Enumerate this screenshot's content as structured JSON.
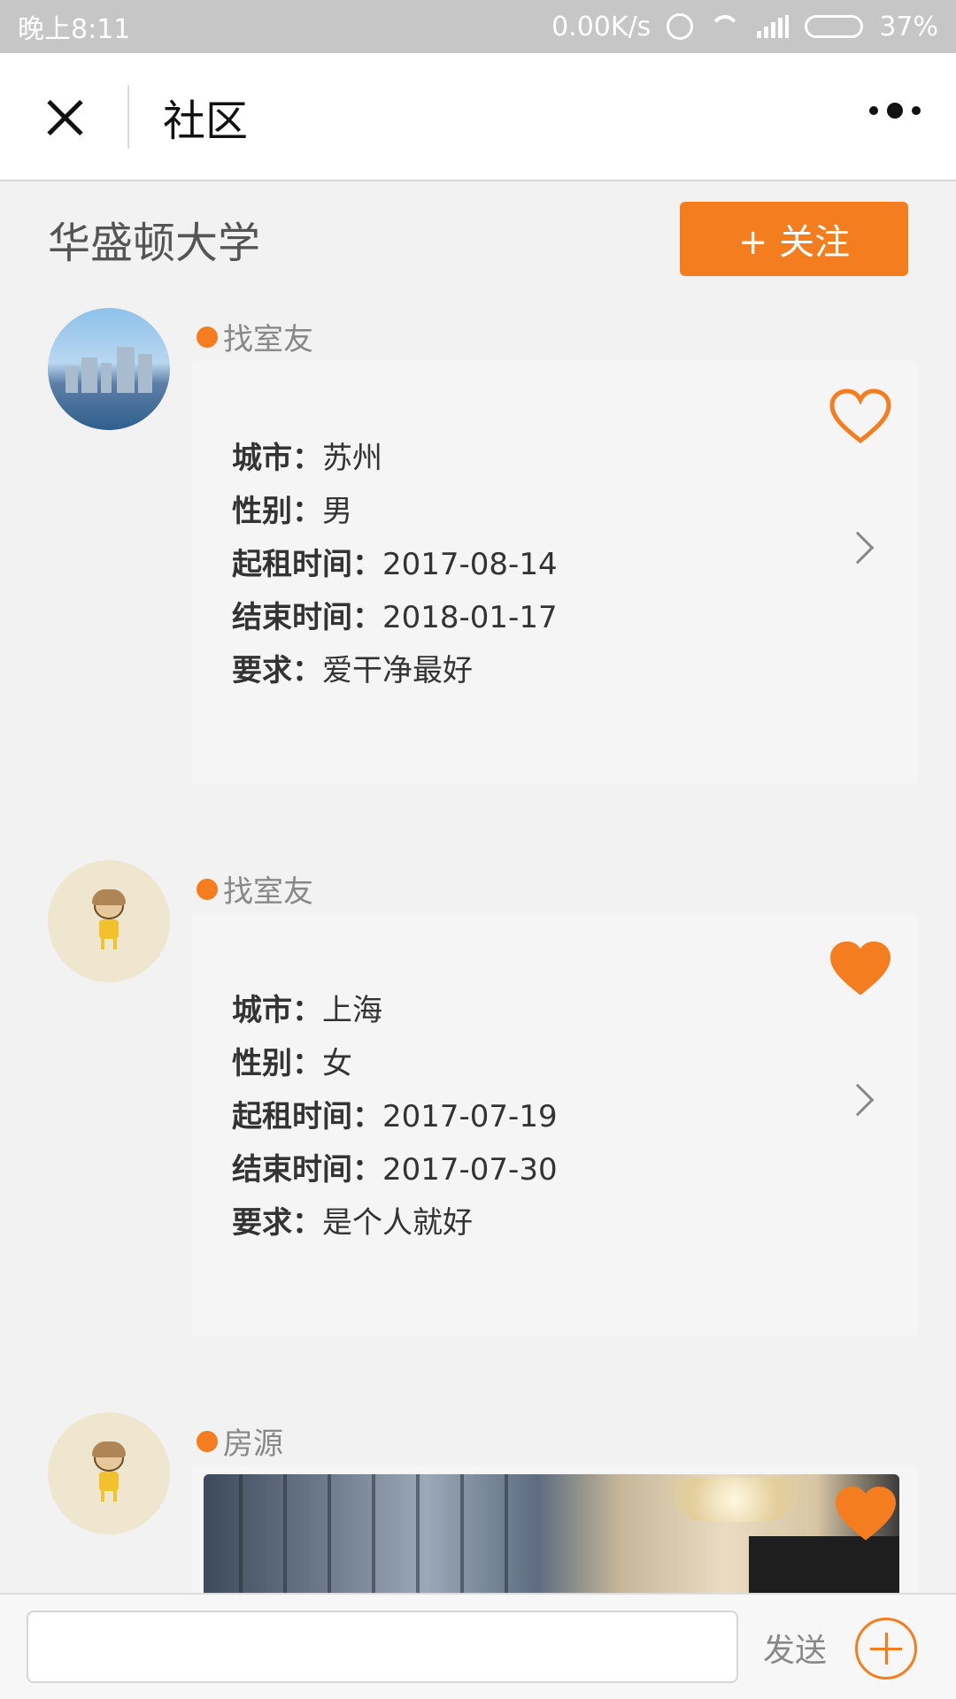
{
  "status_bar": {
    "time": "晚上8:11",
    "net_speed": "0.00K/s",
    "battery": "37%",
    "battery_level": 0.37,
    "icons": [
      "alarm-icon",
      "wifi-icon",
      "signal-icon",
      "battery-icon"
    ]
  },
  "nav": {
    "title": "社区",
    "close_icon": "close-icon",
    "more_icon": "more-dots-icon"
  },
  "community": {
    "name": "华盛顿大学",
    "follow_label": "+ 关注"
  },
  "posts": [
    {
      "tag": "找室友",
      "avatar": "city-skyline-avatar",
      "liked": false,
      "fields": [
        {
          "label": "城市：",
          "value": "苏州"
        },
        {
          "label": "性别：",
          "value": "男"
        },
        {
          "label": "起租时间：",
          "value": "2017-08-14"
        },
        {
          "label": "结束时间：",
          "value": "2018-01-17"
        },
        {
          "label": "要求：",
          "value": "爱干净最好"
        }
      ]
    },
    {
      "tag": "找室友",
      "avatar": "cartoon-avatar",
      "liked": true,
      "fields": [
        {
          "label": "城市：",
          "value": "上海"
        },
        {
          "label": "性别：",
          "value": "女"
        },
        {
          "label": "起租时间：",
          "value": "2017-07-19"
        },
        {
          "label": "结束时间：",
          "value": "2017-07-30"
        },
        {
          "label": "要求：",
          "value": "是个人就好"
        }
      ]
    },
    {
      "tag": "房源",
      "avatar": "cartoon-avatar",
      "liked": true,
      "photo": "living-room-photo"
    }
  ],
  "input_bar": {
    "placeholder": "",
    "send_label": "发送",
    "plus_icon": "plus-circle-icon"
  },
  "colors": {
    "accent": "#f47d20",
    "status_bar_bg": "#c6c6c6",
    "card_bg": "#f5f5f5",
    "text_muted": "#888888"
  }
}
